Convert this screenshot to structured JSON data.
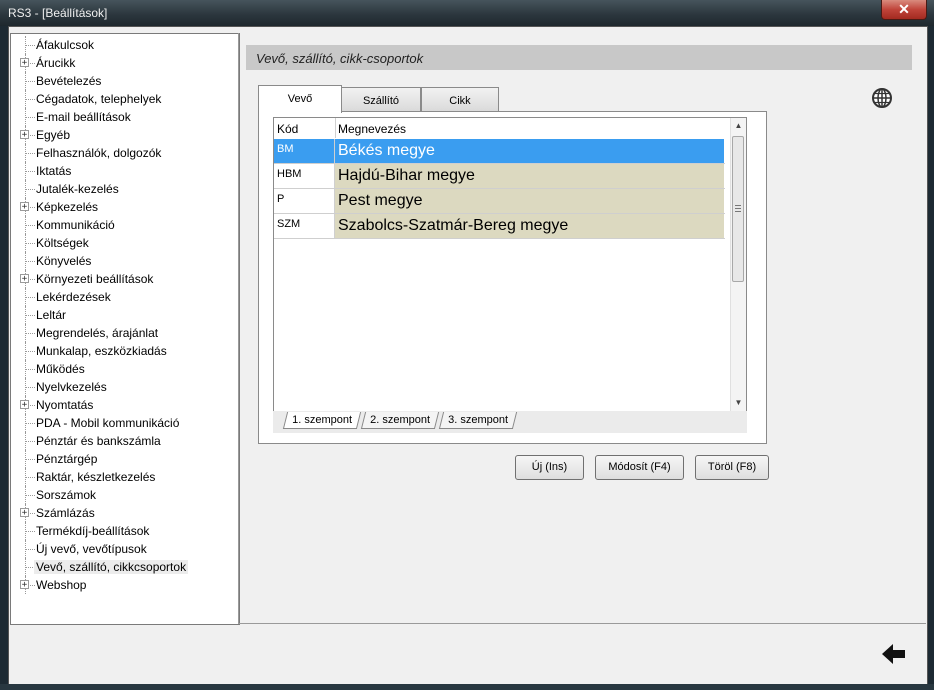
{
  "window": {
    "title": "RS3 - [Beállítások]",
    "close_glyph": "✕"
  },
  "tree": {
    "items": [
      {
        "label": "Áfakulcsok",
        "expandable": false
      },
      {
        "label": "Árucikk",
        "expandable": true
      },
      {
        "label": "Bevételezés",
        "expandable": false
      },
      {
        "label": "Cégadatok, telephelyek",
        "expandable": false
      },
      {
        "label": "E-mail beállítások",
        "expandable": false
      },
      {
        "label": "Egyéb",
        "expandable": true
      },
      {
        "label": "Felhasználók, dolgozók",
        "expandable": false
      },
      {
        "label": "Iktatás",
        "expandable": false
      },
      {
        "label": "Jutalék-kezelés",
        "expandable": false
      },
      {
        "label": "Képkezelés",
        "expandable": true
      },
      {
        "label": "Kommunikáció",
        "expandable": false
      },
      {
        "label": "Költségek",
        "expandable": false
      },
      {
        "label": "Könyvelés",
        "expandable": false
      },
      {
        "label": "Környezeti beállítások",
        "expandable": true
      },
      {
        "label": "Lekérdezések",
        "expandable": false
      },
      {
        "label": "Leltár",
        "expandable": false
      },
      {
        "label": "Megrendelés, árajánlat",
        "expandable": false
      },
      {
        "label": "Munkalap, eszközkiadás",
        "expandable": false
      },
      {
        "label": "Működés",
        "expandable": false
      },
      {
        "label": "Nyelvkezelés",
        "expandable": false
      },
      {
        "label": "Nyomtatás",
        "expandable": true
      },
      {
        "label": "PDA - Mobil kommunikáció",
        "expandable": false
      },
      {
        "label": "Pénztár és bankszámla",
        "expandable": false
      },
      {
        "label": "Pénztárgép",
        "expandable": false
      },
      {
        "label": "Raktár, készletkezelés",
        "expandable": false
      },
      {
        "label": "Sorszámok",
        "expandable": false
      },
      {
        "label": "Számlázás",
        "expandable": true
      },
      {
        "label": "Termékdíj-beállítások",
        "expandable": false
      },
      {
        "label": "Új vevő, vevőtípusok",
        "expandable": false
      },
      {
        "label": "Vevő, szállító, cikkcsoportok",
        "expandable": false,
        "selected": true
      },
      {
        "label": "Webshop",
        "expandable": true
      }
    ]
  },
  "section": {
    "title": "Vevő, szállító, cikk-csoportok"
  },
  "tabs": [
    {
      "label": "Vevő",
      "active": true
    },
    {
      "label": "Szállító",
      "active": false
    },
    {
      "label": "Cikk",
      "active": false
    }
  ],
  "grid": {
    "columns": [
      "Kód",
      "Megnevezés"
    ],
    "rows": [
      {
        "code": "BM",
        "name": "Békés megye",
        "selected": true
      },
      {
        "code": "HBM",
        "name": "Hajdú-Bihar megye",
        "selected": false
      },
      {
        "code": "P",
        "name": "Pest megye",
        "selected": false
      },
      {
        "code": "SZM",
        "name": "Szabolcs-Szatmár-Bereg megye",
        "selected": false
      }
    ]
  },
  "subtabs": [
    {
      "label": "1. szempont",
      "active": true
    },
    {
      "label": "2. szempont",
      "active": false
    },
    {
      "label": "3. szempont",
      "active": false
    }
  ],
  "buttons": {
    "new": "Új (Ins)",
    "modify": "Módosít (F4)",
    "delete": "Töröl (F8)"
  },
  "icons": {
    "globe": "globe-icon",
    "back": "back-arrow-icon",
    "scroll_up": "▲",
    "scroll_down": "▼"
  }
}
